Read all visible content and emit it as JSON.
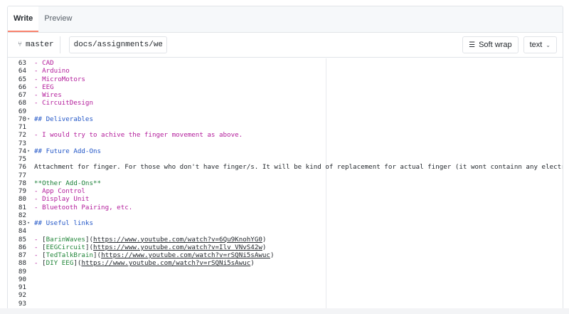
{
  "tabs": [
    {
      "label": "Write",
      "active": true
    },
    {
      "label": "Preview",
      "active": false
    }
  ],
  "toolbar": {
    "branch_icon": "branch-icon",
    "branch": "master",
    "path_value": "docs/assignments/wee",
    "soft_wrap_label": "Soft wrap",
    "mode_label": "text"
  },
  "editor": {
    "lines": [
      {
        "num": "63",
        "fold": "",
        "parts": [
          {
            "t": "- CAD",
            "c": "c-list"
          }
        ]
      },
      {
        "num": "64",
        "fold": "",
        "parts": [
          {
            "t": "- Arduino",
            "c": "c-list"
          }
        ]
      },
      {
        "num": "65",
        "fold": "",
        "parts": [
          {
            "t": "- MicroMotors",
            "c": "c-list"
          }
        ]
      },
      {
        "num": "66",
        "fold": "",
        "parts": [
          {
            "t": "- EEG",
            "c": "c-list"
          }
        ]
      },
      {
        "num": "67",
        "fold": "",
        "parts": [
          {
            "t": "- Wires",
            "c": "c-list"
          }
        ]
      },
      {
        "num": "68",
        "fold": "",
        "parts": [
          {
            "t": "- CircuitDesign",
            "c": "c-list"
          }
        ]
      },
      {
        "num": "69",
        "fold": "",
        "parts": []
      },
      {
        "num": "70",
        "fold": "▾",
        "parts": [
          {
            "t": "## Deliverables",
            "c": "c-head"
          }
        ]
      },
      {
        "num": "71",
        "fold": "",
        "parts": []
      },
      {
        "num": "72",
        "fold": "",
        "parts": [
          {
            "t": "- I would try to achive the finger movement as above.",
            "c": "c-list"
          }
        ]
      },
      {
        "num": "73",
        "fold": "",
        "parts": []
      },
      {
        "num": "74",
        "fold": "▾",
        "parts": [
          {
            "t": "## Future Add-Ons",
            "c": "c-head"
          }
        ]
      },
      {
        "num": "75",
        "fold": "",
        "parts": []
      },
      {
        "num": "76",
        "fold": "",
        "parts": [
          {
            "t": "Attachment for finger. For those who don't have finger/s. It will be kind of replacement for actual finger (it wont containn any electrical part.",
            "c": ""
          }
        ]
      },
      {
        "num": "77",
        "fold": "",
        "parts": []
      },
      {
        "num": "78",
        "fold": "",
        "parts": [
          {
            "t": "**Other Add-Ons**",
            "c": "c-bold"
          }
        ]
      },
      {
        "num": "79",
        "fold": "",
        "parts": [
          {
            "t": "- App Control",
            "c": "c-list"
          }
        ]
      },
      {
        "num": "80",
        "fold": "",
        "parts": [
          {
            "t": "- Display Unit",
            "c": "c-list"
          }
        ]
      },
      {
        "num": "81",
        "fold": "",
        "parts": [
          {
            "t": "- Bluetooth Pairing, etc.",
            "c": "c-list"
          }
        ]
      },
      {
        "num": "82",
        "fold": "",
        "parts": []
      },
      {
        "num": "83",
        "fold": "▾",
        "parts": [
          {
            "t": "## Useful links",
            "c": "c-head"
          }
        ]
      },
      {
        "num": "84",
        "fold": "",
        "parts": []
      },
      {
        "num": "85",
        "fold": "",
        "parts": [
          {
            "t": "- ",
            "c": "c-list"
          },
          {
            "t": "[",
            "c": "c-link-b"
          },
          {
            "t": "BarinWaves",
            "c": "c-link-t"
          },
          {
            "t": "](",
            "c": "c-link-b"
          },
          {
            "t": "https://www.youtube.com/watch?v=6Qu9KnohYG0",
            "c": "c-url"
          },
          {
            "t": ")",
            "c": "c-link-b"
          }
        ]
      },
      {
        "num": "86",
        "fold": "",
        "parts": [
          {
            "t": "- ",
            "c": "c-list"
          },
          {
            "t": "[",
            "c": "c-link-b"
          },
          {
            "t": "EEGCircuit",
            "c": "c-link-t"
          },
          {
            "t": "](",
            "c": "c-link-b"
          },
          {
            "t": "https://www.youtube.com/watch?v=Ilv_VNvS42w",
            "c": "c-url"
          },
          {
            "t": ")",
            "c": "c-link-b"
          }
        ]
      },
      {
        "num": "87",
        "fold": "",
        "parts": [
          {
            "t": "- ",
            "c": "c-list"
          },
          {
            "t": "[",
            "c": "c-link-b"
          },
          {
            "t": "TedTalkBrain",
            "c": "c-link-t"
          },
          {
            "t": "](",
            "c": "c-link-b"
          },
          {
            "t": "https://www.youtube.com/watch?v=rSQNi5sAwuc",
            "c": "c-url"
          },
          {
            "t": ")",
            "c": "c-link-b"
          }
        ]
      },
      {
        "num": "88",
        "fold": "",
        "parts": [
          {
            "t": "- ",
            "c": "c-list"
          },
          {
            "t": "[",
            "c": "c-link-b"
          },
          {
            "t": "DIY EEG",
            "c": "c-link-t"
          },
          {
            "t": "](",
            "c": "c-link-b"
          },
          {
            "t": "https://www.youtube.com/watch?v=rSQNi5sAwuc",
            "c": "c-url"
          },
          {
            "t": ")",
            "c": "c-link-b"
          }
        ]
      },
      {
        "num": "89",
        "fold": "",
        "parts": []
      },
      {
        "num": "90",
        "fold": "",
        "parts": []
      },
      {
        "num": "91",
        "fold": "",
        "parts": []
      },
      {
        "num": "92",
        "fold": "",
        "parts": []
      },
      {
        "num": "93",
        "fold": "",
        "parts": []
      }
    ]
  },
  "colors": {
    "list": "#b31d9b",
    "heading": "#2256c7",
    "bold": "#1a7f37",
    "tab_underline": "#f9826c"
  }
}
